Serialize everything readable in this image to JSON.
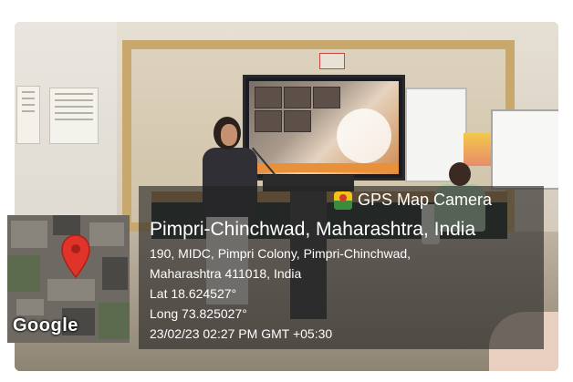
{
  "gps_overlay": {
    "app_name": "GPS Map Camera",
    "map_brand": "Google",
    "location_title": "Pimpri-Chinchwad, Maharashtra, India",
    "address_line1": "190, MIDC, Pimpri Colony, Pimpri-Chinchwad,",
    "address_line2": "Maharashtra 411018, India",
    "latitude": "Lat 18.624527°",
    "longitude": "Long 73.825027°",
    "timestamp": "23/02/23 02:27 PM GMT +05:30"
  },
  "icons": {
    "camera_badge": "gps-map-camera-icon",
    "pin": "map-pin-icon"
  },
  "colors": {
    "pin": "#e0342b",
    "overlay": "#232323"
  }
}
